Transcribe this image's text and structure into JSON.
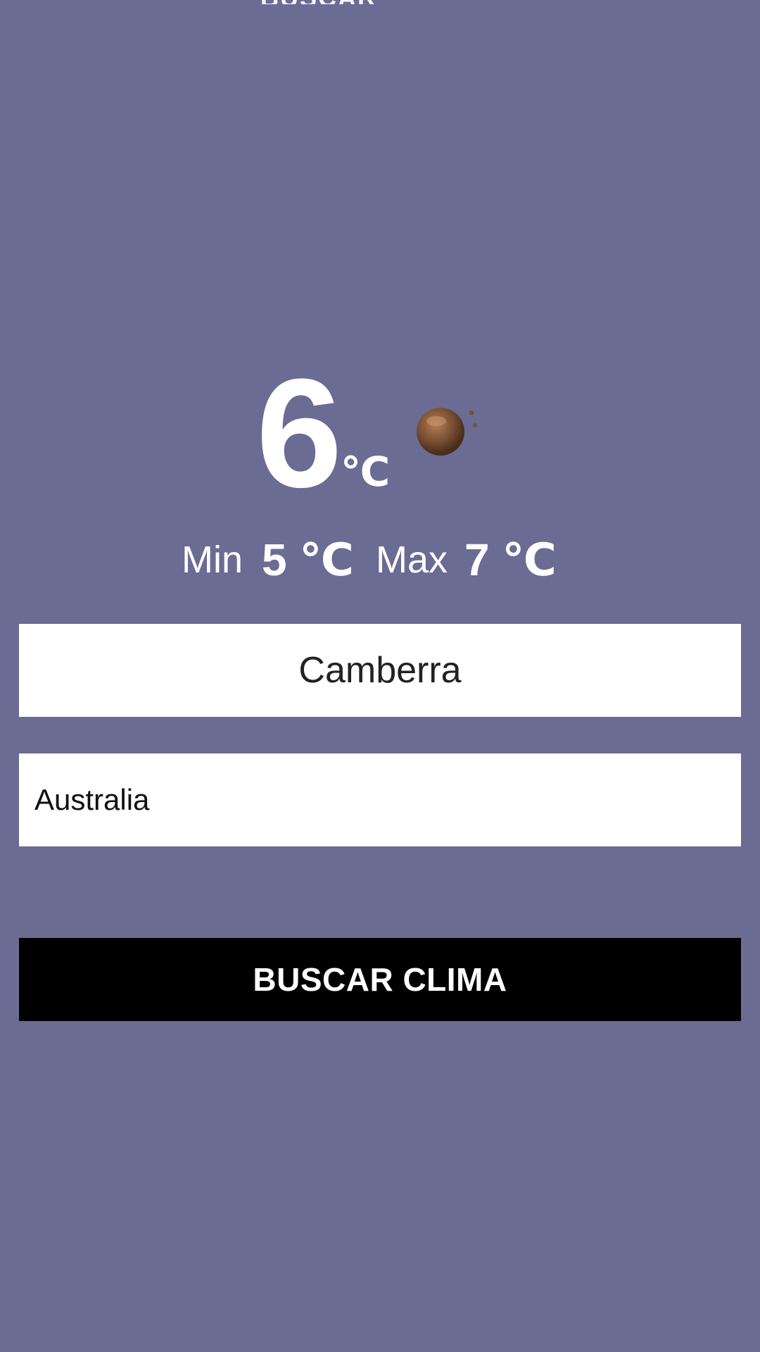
{
  "weather": {
    "temperature": "6",
    "unit": "℃",
    "min_label": "Min",
    "min_value": "5 ℃",
    "max_label": "Max",
    "max_value": "7 ℃",
    "icon": "weather-condition-icon"
  },
  "form": {
    "city_value": "Camberra",
    "country_value": "Australia",
    "search_label": "BUSCAR CLIMA"
  },
  "colors": {
    "background": "#6b6c94",
    "button": "#000000",
    "icon": "#7a4f33"
  }
}
